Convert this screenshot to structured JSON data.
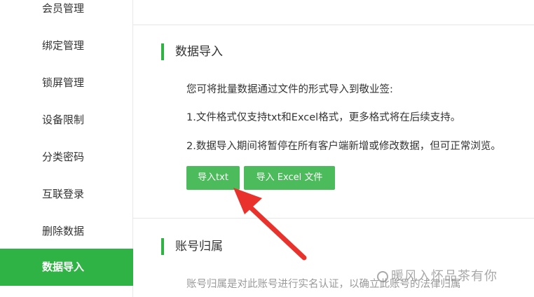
{
  "sidebar": {
    "items": [
      {
        "label": "会员管理",
        "active": false
      },
      {
        "label": "绑定管理",
        "active": false
      },
      {
        "label": "锁屏管理",
        "active": false
      },
      {
        "label": "设备限制",
        "active": false
      },
      {
        "label": "分类密码",
        "active": false
      },
      {
        "label": "互联登录",
        "active": false
      },
      {
        "label": "删除数据",
        "active": false
      },
      {
        "label": "数据导入",
        "active": true
      }
    ]
  },
  "import_section": {
    "title": "数据导入",
    "intro": "您可将批量数据通过文件的形式导入到敬业签:",
    "note1": "1.文件格式仅支持txt和Excel格式，更多格式将在后续支持。",
    "note2": "2.数据导入期间将暂停在所有客户端新增或修改数据，但可正常浏览。",
    "btn_txt": "导入txt",
    "btn_excel": "导入 Excel 文件"
  },
  "account_section": {
    "title": "账号归属",
    "desc": "账号归属是对此账号进行实名认证，以确立此账号的法律归属"
  },
  "watermark": "暖风入怀品茶有你",
  "colors": {
    "accent": "#2fb344",
    "button": "#4cbb5b",
    "arrow": "#e8322b"
  }
}
